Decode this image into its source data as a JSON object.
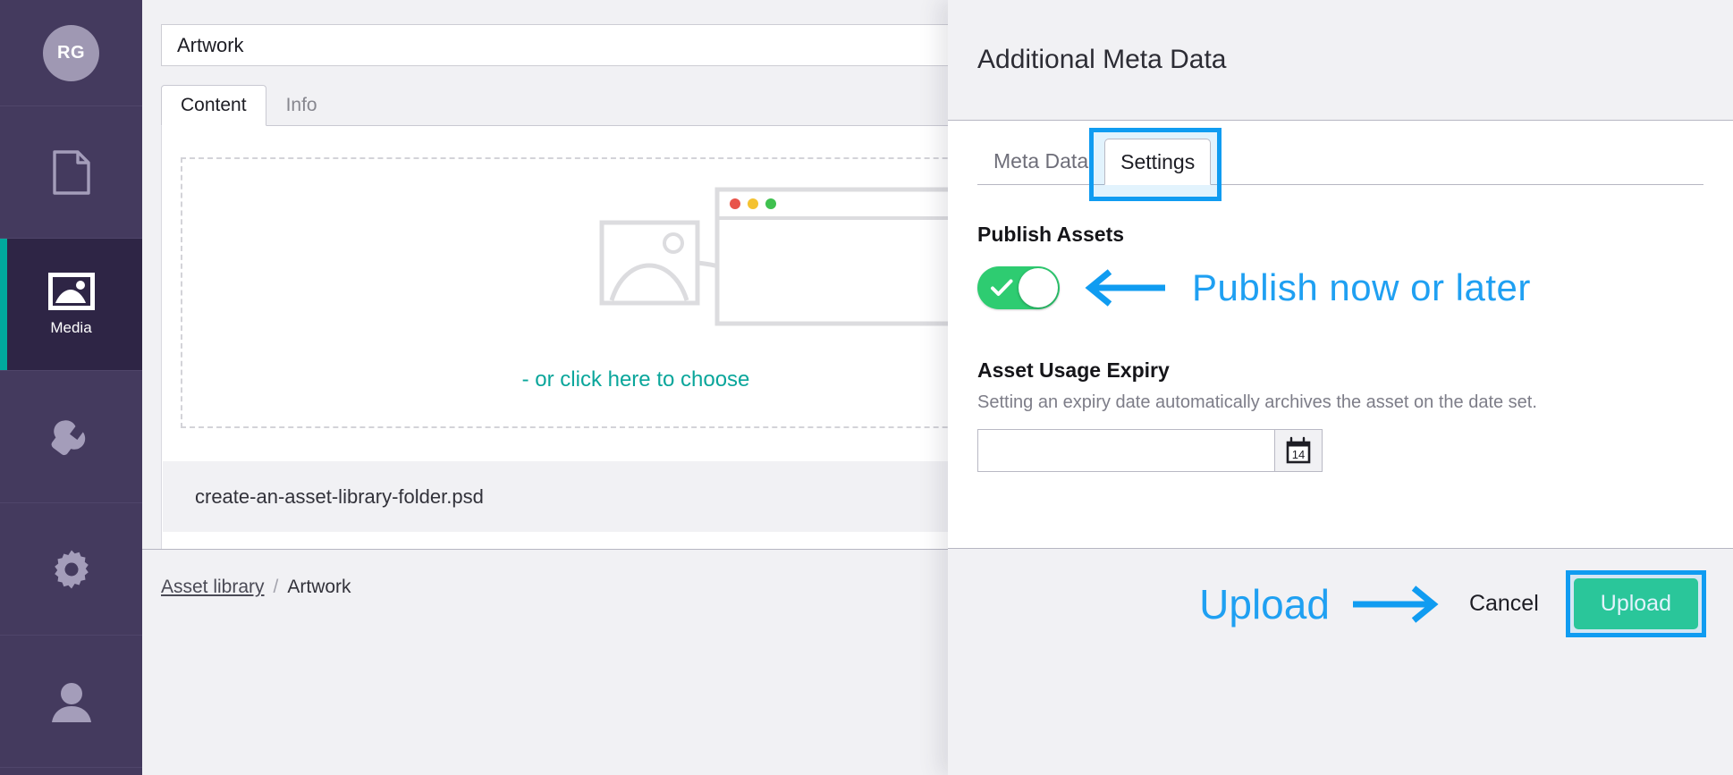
{
  "sidebar": {
    "avatar_initials": "RG",
    "items": [
      {
        "icon": "document-icon",
        "label": "",
        "active": false
      },
      {
        "icon": "media-image-icon",
        "label": "Media",
        "active": true
      },
      {
        "icon": "wrench-icon",
        "label": "",
        "active": false
      },
      {
        "icon": "gear-icon",
        "label": "",
        "active": false
      },
      {
        "icon": "user-icon",
        "label": "",
        "active": false
      }
    ]
  },
  "main": {
    "title_value": "Artwork",
    "title_placeholder": "Title",
    "tabs": [
      {
        "label": "Content",
        "active": true
      },
      {
        "label": "Info",
        "active": false
      }
    ],
    "dropzone": {
      "hint": "- or click here to choose",
      "illustration": "image-to-browser-illustration",
      "browser_dots": [
        "#e8544a",
        "#f4c231",
        "#3fc14f"
      ]
    },
    "file_row": {
      "filename": "create-an-asset-library-folder.psd"
    },
    "breadcrumb": {
      "link": "Asset library",
      "separator": "/",
      "current": "Artwork"
    }
  },
  "meta_panel": {
    "title": "Additional Meta Data",
    "tabs": [
      {
        "label": "Meta Data",
        "active": false
      },
      {
        "label": "Settings",
        "active": true
      }
    ],
    "publish": {
      "label": "Publish Assets",
      "toggle_on": true,
      "toggle_icon": "check-icon"
    },
    "expiry": {
      "label": "Asset Usage Expiry",
      "description": "Setting an expiry date automatically archives the asset on the date set.",
      "input_value": "",
      "input_placeholder": "",
      "calendar_icon": "calendar-icon",
      "calendar_day": "14"
    },
    "footer": {
      "cancel_label": "Cancel",
      "upload_label": "Upload"
    }
  },
  "annotations": {
    "publish_note": "Publish now or later",
    "upload_note": "Upload",
    "arrow_left": "left-arrow-icon",
    "arrow_right": "right-arrow-icon",
    "highlight_color": "#109cf1",
    "highlight_targets": [
      "settings-tab",
      "upload-button"
    ]
  },
  "colors": {
    "sidebar_bg": "#443a5e",
    "sidebar_active_bg": "#2e2545",
    "accent_teal": "#00a99d",
    "toggle_green": "#2ecc71",
    "upload_green": "#2ecc8f",
    "annotation_blue": "#109cf1"
  }
}
